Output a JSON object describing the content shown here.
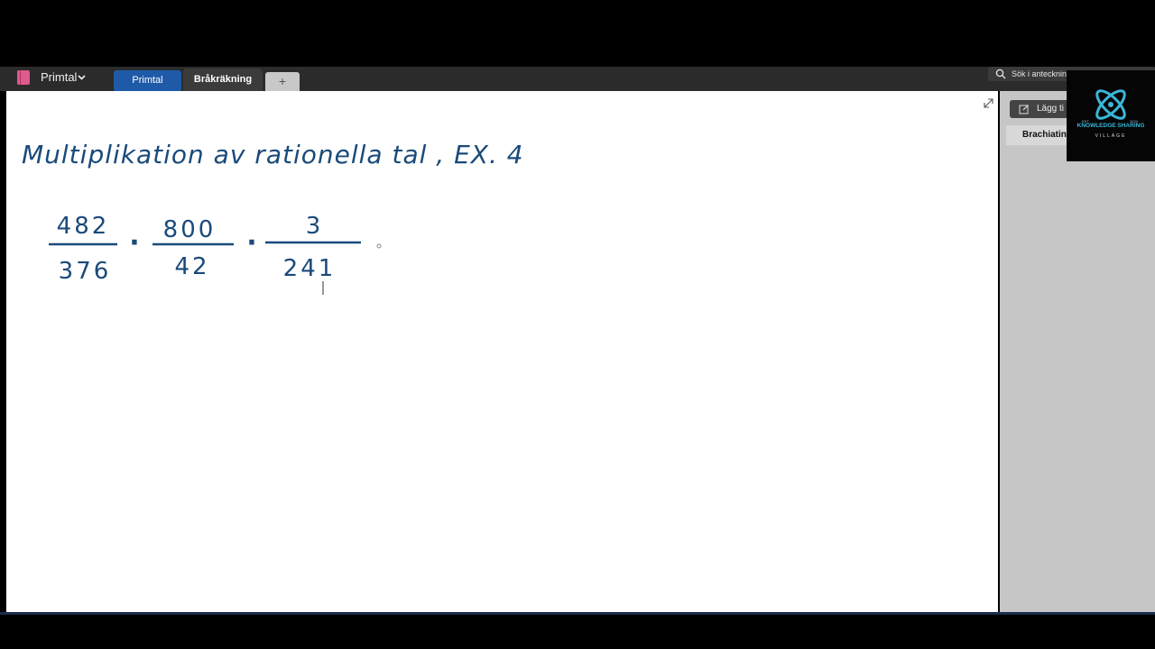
{
  "notebook": {
    "name": "Primtal"
  },
  "tabs": [
    {
      "label": "Primtal"
    },
    {
      "label": "Bråkräkning"
    },
    {
      "label": "+"
    }
  ],
  "search": {
    "placeholder": "Sök i anteckning"
  },
  "page_pane": {
    "add_page_label": "Lägg ti",
    "pages": [
      {
        "label": "Brachiating"
      }
    ]
  },
  "canvas": {
    "handwritten_title": "Multiplikation av rationella tal , EX. 4",
    "expression": {
      "fractions": [
        {
          "numerator": "482",
          "denominator": "376"
        },
        {
          "numerator": "800",
          "denominator": "42"
        },
        {
          "numerator": "3",
          "denominator": "241"
        }
      ],
      "operator": "·"
    }
  },
  "watermark": {
    "title": "KNOWLEDGE SHARING",
    "subtitle": "VILLAGE",
    "year_left": "EST",
    "year_right": "2024"
  },
  "colors": {
    "ink": "#1a4a7a",
    "accent": "#1e5aa8",
    "logo": "#3ab6d8"
  }
}
